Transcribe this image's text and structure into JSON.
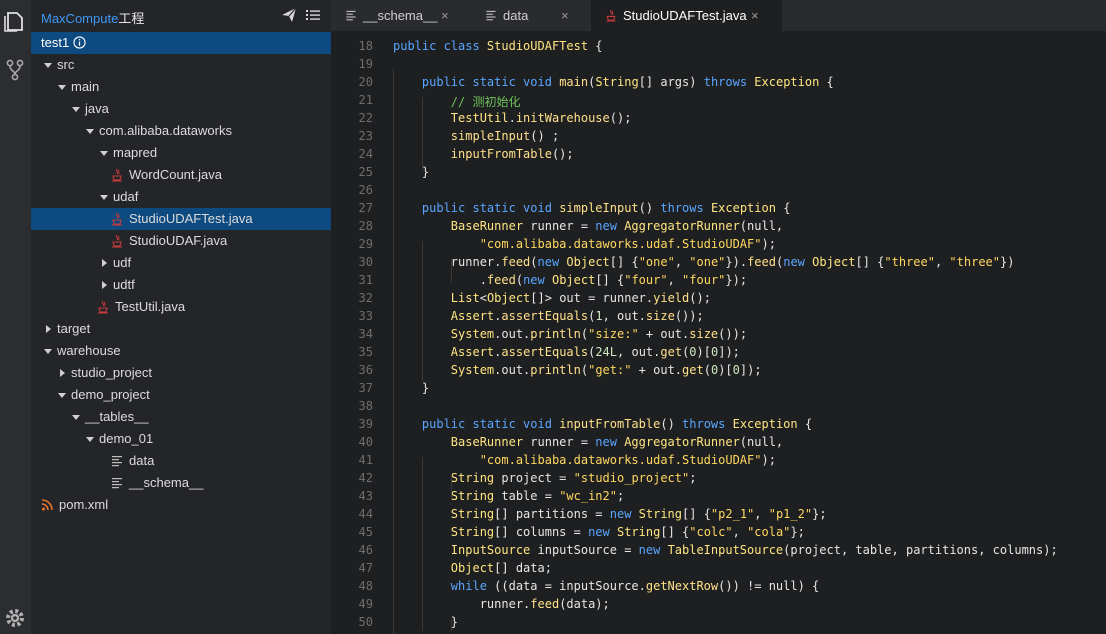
{
  "activity_bar": {
    "top_icons": [
      "files-icon",
      "source-control-icon"
    ],
    "bottom_icon": "gear-icon"
  },
  "sidebar": {
    "title": "MaxCompute",
    "title_suffix": "工程",
    "header_icons": [
      "send-icon",
      "list-icon"
    ],
    "project": {
      "label": "test1",
      "icon": "info-icon"
    },
    "tree": [
      {
        "label": "src",
        "kind": "folder",
        "expanded": true,
        "depth": 0
      },
      {
        "label": "main",
        "kind": "folder",
        "expanded": true,
        "depth": 1
      },
      {
        "label": "java",
        "kind": "folder",
        "expanded": true,
        "depth": 2
      },
      {
        "label": "com.alibaba.dataworks",
        "kind": "folder",
        "expanded": true,
        "depth": 3
      },
      {
        "label": "mapred",
        "kind": "folder",
        "expanded": true,
        "depth": 4
      },
      {
        "label": "WordCount.java",
        "kind": "java",
        "depth": 5
      },
      {
        "label": "udaf",
        "kind": "folder",
        "expanded": true,
        "depth": 4
      },
      {
        "label": "StudioUDAFTest.java",
        "kind": "java",
        "depth": 5,
        "selected": true
      },
      {
        "label": "StudioUDAF.java",
        "kind": "java",
        "depth": 5
      },
      {
        "label": "udf",
        "kind": "folder",
        "expanded": false,
        "depth": 4
      },
      {
        "label": "udtf",
        "kind": "folder",
        "expanded": false,
        "depth": 4
      },
      {
        "label": "TestUtil.java",
        "kind": "java",
        "depth": 4
      },
      {
        "label": "target",
        "kind": "folder",
        "expanded": false,
        "depth": 0
      },
      {
        "label": "warehouse",
        "kind": "folder",
        "expanded": true,
        "depth": 0
      },
      {
        "label": "studio_project",
        "kind": "folder",
        "expanded": false,
        "depth": 1
      },
      {
        "label": "demo_project",
        "kind": "folder",
        "expanded": true,
        "depth": 1
      },
      {
        "label": "__tables__",
        "kind": "folder",
        "expanded": true,
        "depth": 2
      },
      {
        "label": "demo_01",
        "kind": "folder",
        "expanded": true,
        "depth": 3
      },
      {
        "label": "data",
        "kind": "text",
        "depth": 5
      },
      {
        "label": "__schema__",
        "kind": "text",
        "depth": 5
      },
      {
        "label": "pom.xml",
        "kind": "rss",
        "depth": 0
      }
    ]
  },
  "tabs": [
    {
      "label": "__schema__",
      "icon": "text-file-icon",
      "active": false
    },
    {
      "label": "data",
      "icon": "text-file-icon",
      "active": false
    },
    {
      "label": "StudioUDAFTest.java",
      "icon": "java-file-icon",
      "active": true
    }
  ],
  "tab_close_glyph": "×",
  "editor": {
    "lines": [
      {
        "n": 18,
        "tokens": [
          [
            "public class ",
            "kw"
          ],
          [
            "StudioUDAFTest",
            "ty"
          ],
          [
            " {",
            ""
          ]
        ]
      },
      {
        "n": 19,
        "tokens": []
      },
      {
        "n": 20,
        "tokens": [
          [
            "    ",
            ""
          ],
          [
            "public static void ",
            "kw"
          ],
          [
            "main",
            "fn"
          ],
          [
            "(",
            ""
          ],
          [
            "String",
            "ty"
          ],
          [
            "[] args) ",
            ""
          ],
          [
            "throws ",
            "kw"
          ],
          [
            "Exception",
            "ty"
          ],
          [
            " {",
            ""
          ]
        ]
      },
      {
        "n": 21,
        "tokens": [
          [
            "        ",
            ""
          ],
          [
            "// 测初始化",
            "cm"
          ]
        ]
      },
      {
        "n": 22,
        "tokens": [
          [
            "        ",
            ""
          ],
          [
            "TestUtil",
            "ty"
          ],
          [
            ".",
            ""
          ],
          [
            "initWarehouse",
            "fn"
          ],
          [
            "();",
            ""
          ]
        ]
      },
      {
        "n": 23,
        "tokens": [
          [
            "        ",
            ""
          ],
          [
            "simpleInput",
            "fn"
          ],
          [
            "() ;",
            ""
          ]
        ]
      },
      {
        "n": 24,
        "tokens": [
          [
            "        ",
            ""
          ],
          [
            "inputFromTable",
            "fn"
          ],
          [
            "();",
            ""
          ]
        ]
      },
      {
        "n": 25,
        "tokens": [
          [
            "    }",
            ""
          ]
        ]
      },
      {
        "n": 26,
        "tokens": []
      },
      {
        "n": 27,
        "tokens": [
          [
            "    ",
            ""
          ],
          [
            "public static void ",
            "kw"
          ],
          [
            "simpleInput",
            "fn"
          ],
          [
            "() ",
            ""
          ],
          [
            "throws ",
            "kw"
          ],
          [
            "Exception",
            "ty"
          ],
          [
            " {",
            ""
          ]
        ]
      },
      {
        "n": 28,
        "tokens": [
          [
            "        ",
            ""
          ],
          [
            "BaseRunner",
            "ty"
          ],
          [
            " runner = ",
            ""
          ],
          [
            "new ",
            "kw"
          ],
          [
            "AggregatorRunner",
            "ty"
          ],
          [
            "(null,",
            ""
          ]
        ]
      },
      {
        "n": 29,
        "tokens": [
          [
            "            ",
            ""
          ],
          [
            "\"com.alibaba.dataworks.udaf.StudioUDAF\"",
            "st"
          ],
          [
            ");",
            ""
          ]
        ]
      },
      {
        "n": 30,
        "tokens": [
          [
            "        runner.",
            ""
          ],
          [
            "feed",
            "fn"
          ],
          [
            "(",
            ""
          ],
          [
            "new ",
            "kw"
          ],
          [
            "Object",
            "ty"
          ],
          [
            "[] {",
            ""
          ],
          [
            "\"one\"",
            "st"
          ],
          [
            ", ",
            ""
          ],
          [
            "\"one\"",
            "st"
          ],
          [
            "}).",
            ""
          ],
          [
            "feed",
            "fn"
          ],
          [
            "(",
            ""
          ],
          [
            "new ",
            "kw"
          ],
          [
            "Object",
            "ty"
          ],
          [
            "[] {",
            ""
          ],
          [
            "\"three\"",
            "st"
          ],
          [
            ", ",
            ""
          ],
          [
            "\"three\"",
            "st"
          ],
          [
            "})",
            ""
          ]
        ]
      },
      {
        "n": 31,
        "tokens": [
          [
            "            .",
            ""
          ],
          [
            "feed",
            "fn"
          ],
          [
            "(",
            ""
          ],
          [
            "new ",
            "kw"
          ],
          [
            "Object",
            "ty"
          ],
          [
            "[] {",
            ""
          ],
          [
            "\"four\"",
            "st"
          ],
          [
            ", ",
            ""
          ],
          [
            "\"four\"",
            "st"
          ],
          [
            "});",
            ""
          ]
        ]
      },
      {
        "n": 32,
        "tokens": [
          [
            "        ",
            ""
          ],
          [
            "List",
            "ty"
          ],
          [
            "<",
            ""
          ],
          [
            "Object",
            "ty"
          ],
          [
            "[]> out = runner.",
            ""
          ],
          [
            "yield",
            "fn"
          ],
          [
            "();",
            ""
          ]
        ]
      },
      {
        "n": 33,
        "tokens": [
          [
            "        ",
            ""
          ],
          [
            "Assert",
            "ty"
          ],
          [
            ".",
            ""
          ],
          [
            "assertEquals",
            "fn"
          ],
          [
            "(",
            ""
          ],
          [
            "1",
            "nu"
          ],
          [
            ", out.",
            ""
          ],
          [
            "size",
            "fn"
          ],
          [
            "());",
            ""
          ]
        ]
      },
      {
        "n": 34,
        "tokens": [
          [
            "        ",
            ""
          ],
          [
            "System",
            "ty"
          ],
          [
            ".out.",
            ""
          ],
          [
            "println",
            "fn"
          ],
          [
            "(",
            ""
          ],
          [
            "\"size:\"",
            "st"
          ],
          [
            " + out.",
            ""
          ],
          [
            "size",
            "fn"
          ],
          [
            "());",
            ""
          ]
        ]
      },
      {
        "n": 35,
        "tokens": [
          [
            "        ",
            ""
          ],
          [
            "Assert",
            "ty"
          ],
          [
            ".",
            ""
          ],
          [
            "assertEquals",
            "fn"
          ],
          [
            "(",
            ""
          ],
          [
            "24L",
            "nu"
          ],
          [
            ", out.",
            ""
          ],
          [
            "get",
            "fn"
          ],
          [
            "(",
            ""
          ],
          [
            "0",
            "nu"
          ],
          [
            ")[",
            ""
          ],
          [
            "0",
            "nu"
          ],
          [
            "]);",
            ""
          ]
        ]
      },
      {
        "n": 36,
        "tokens": [
          [
            "        ",
            ""
          ],
          [
            "System",
            "ty"
          ],
          [
            ".out.",
            ""
          ],
          [
            "println",
            "fn"
          ],
          [
            "(",
            ""
          ],
          [
            "\"get:\"",
            "st"
          ],
          [
            " + out.",
            ""
          ],
          [
            "get",
            "fn"
          ],
          [
            "(",
            ""
          ],
          [
            "0",
            "nu"
          ],
          [
            ")[",
            ""
          ],
          [
            "0",
            "nu"
          ],
          [
            "]);",
            ""
          ]
        ]
      },
      {
        "n": 37,
        "tokens": [
          [
            "    }",
            ""
          ]
        ]
      },
      {
        "n": 38,
        "tokens": []
      },
      {
        "n": 39,
        "tokens": [
          [
            "    ",
            ""
          ],
          [
            "public static void ",
            "kw"
          ],
          [
            "inputFromTable",
            "fn"
          ],
          [
            "() ",
            ""
          ],
          [
            "throws ",
            "kw"
          ],
          [
            "Exception",
            "ty"
          ],
          [
            " {",
            ""
          ]
        ]
      },
      {
        "n": 40,
        "tokens": [
          [
            "        ",
            ""
          ],
          [
            "BaseRunner",
            "ty"
          ],
          [
            " runner = ",
            ""
          ],
          [
            "new ",
            "kw"
          ],
          [
            "AggregatorRunner",
            "ty"
          ],
          [
            "(null,",
            ""
          ]
        ]
      },
      {
        "n": 41,
        "tokens": [
          [
            "            ",
            ""
          ],
          [
            "\"com.alibaba.dataworks.udaf.StudioUDAF\"",
            "st"
          ],
          [
            ");",
            ""
          ]
        ]
      },
      {
        "n": 42,
        "tokens": [
          [
            "        ",
            ""
          ],
          [
            "String",
            "ty"
          ],
          [
            " project = ",
            ""
          ],
          [
            "\"studio_project\"",
            "st"
          ],
          [
            ";",
            ""
          ]
        ]
      },
      {
        "n": 43,
        "tokens": [
          [
            "        ",
            ""
          ],
          [
            "String",
            "ty"
          ],
          [
            " table = ",
            ""
          ],
          [
            "\"wc_in2\"",
            "st"
          ],
          [
            ";",
            ""
          ]
        ]
      },
      {
        "n": 44,
        "tokens": [
          [
            "        ",
            ""
          ],
          [
            "String",
            "ty"
          ],
          [
            "[] partitions = ",
            ""
          ],
          [
            "new ",
            "kw"
          ],
          [
            "String",
            "ty"
          ],
          [
            "[] {",
            ""
          ],
          [
            "\"p2_1\"",
            "st"
          ],
          [
            ", ",
            ""
          ],
          [
            "\"p1_2\"",
            "st"
          ],
          [
            "};",
            ""
          ]
        ]
      },
      {
        "n": 45,
        "tokens": [
          [
            "        ",
            ""
          ],
          [
            "String",
            "ty"
          ],
          [
            "[] columns = ",
            ""
          ],
          [
            "new ",
            "kw"
          ],
          [
            "String",
            "ty"
          ],
          [
            "[] {",
            ""
          ],
          [
            "\"colc\"",
            "st"
          ],
          [
            ", ",
            ""
          ],
          [
            "\"cola\"",
            "st"
          ],
          [
            "};",
            ""
          ]
        ]
      },
      {
        "n": 46,
        "tokens": [
          [
            "        ",
            ""
          ],
          [
            "InputSource",
            "ty"
          ],
          [
            " inputSource = ",
            ""
          ],
          [
            "new ",
            "kw"
          ],
          [
            "TableInputSource",
            "ty"
          ],
          [
            "(project, table, partitions, columns);",
            ""
          ]
        ]
      },
      {
        "n": 47,
        "tokens": [
          [
            "        ",
            ""
          ],
          [
            "Object",
            "ty"
          ],
          [
            "[] data;",
            ""
          ]
        ]
      },
      {
        "n": 48,
        "tokens": [
          [
            "        ",
            ""
          ],
          [
            "while ",
            "kw"
          ],
          [
            "((data = inputSource.",
            ""
          ],
          [
            "getNextRow",
            "fn"
          ],
          [
            "()) != null) {",
            ""
          ]
        ]
      },
      {
        "n": 49,
        "tokens": [
          [
            "            runner.",
            ""
          ],
          [
            "feed",
            "fn"
          ],
          [
            "(data);",
            ""
          ]
        ]
      },
      {
        "n": 50,
        "tokens": [
          [
            "        }",
            ""
          ]
        ]
      }
    ]
  }
}
